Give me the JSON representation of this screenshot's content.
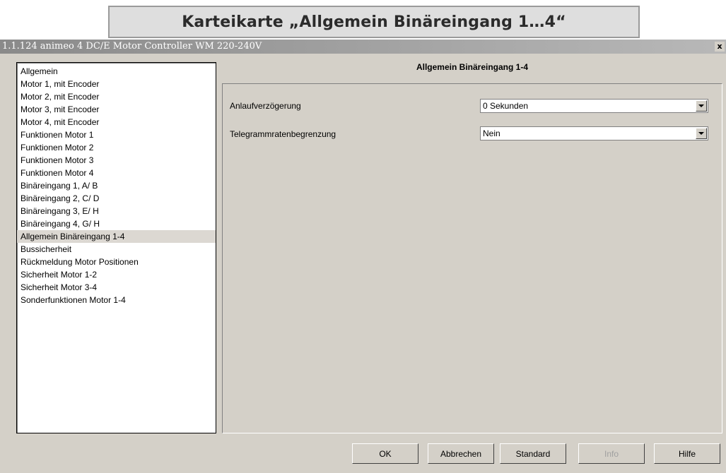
{
  "banner": {
    "text": "Karteikarte „Allgemein Binäreingang 1…4“"
  },
  "window": {
    "title": "1.1.124 animeo 4 DC/E Motor Controller WM 220-240V",
    "close_label": "x"
  },
  "nav": {
    "items": [
      {
        "label": "Allgemein"
      },
      {
        "label": "Motor 1, mit Encoder"
      },
      {
        "label": "Motor 2, mit Encoder"
      },
      {
        "label": "Motor 3, mit Encoder"
      },
      {
        "label": "Motor 4, mit Encoder"
      },
      {
        "label": "Funktionen Motor 1"
      },
      {
        "label": "Funktionen Motor 2"
      },
      {
        "label": "Funktionen Motor 3"
      },
      {
        "label": "Funktionen Motor 4"
      },
      {
        "label": "Binäreingang 1, A/ B"
      },
      {
        "label": "Binäreingang 2, C/ D"
      },
      {
        "label": "Binäreingang 3, E/ H"
      },
      {
        "label": "Binäreingang 4, G/ H"
      },
      {
        "label": "Allgemein Binäreingang 1-4",
        "selected": true
      },
      {
        "label": "Bussicherheit"
      },
      {
        "label": "Rückmeldung Motor Positionen"
      },
      {
        "label": "Sicherheit Motor 1-2"
      },
      {
        "label": "Sicherheit Motor 3-4"
      },
      {
        "label": "Sonderfunktionen Motor 1-4"
      }
    ]
  },
  "content": {
    "title": "Allgemein Binäreingang 1-4",
    "params": [
      {
        "label": "Anlaufverzögerung",
        "value": "0 Sekunden"
      },
      {
        "label": "Telegrammratenbegrenzung",
        "value": "Nein"
      }
    ]
  },
  "buttons": {
    "ok": "OK",
    "cancel": "Abbrechen",
    "default": "Standard",
    "info": "Info",
    "help": "Hilfe"
  },
  "colors": {
    "window_bg": "#d4d0c8",
    "selected_bg": "#dcd8d2"
  }
}
